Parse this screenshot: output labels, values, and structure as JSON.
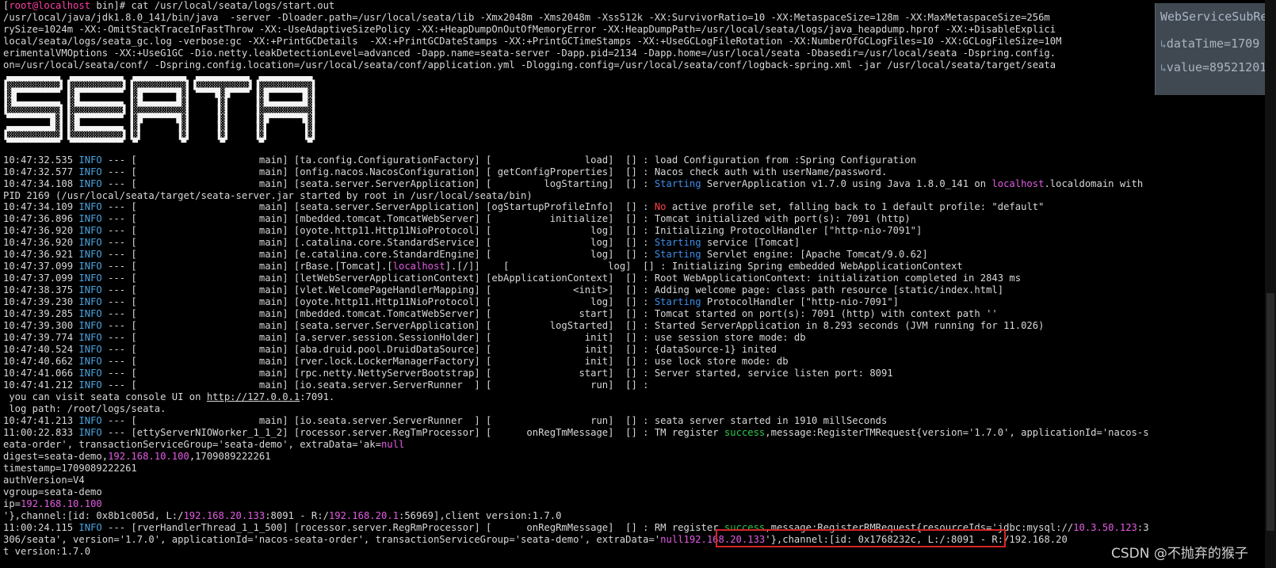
{
  "terminal": {
    "prompt_user": "root@",
    "prompt_host": "localhost",
    "prompt_rest": " bin]# cat /usr/local/seata/logs/start.out",
    "cmd_lines": [
      "/usr/local/java/jdk1.8.0_141/bin/java  -server -Dloader.path=/usr/local/seata/lib -Xmx2048m -Xms2048m -Xss512k -XX:SurvivorRatio=10 -XX:MetaspaceSize=128m -XX:MaxMetaspaceSize=256m",
      "rySize=1024m -XX:-OmitStackTraceInFastThrow -XX:-UseAdaptiveSizePolicy -XX:+HeapDumpOnOutOfMemoryError -XX:HeapDumpPath=/usr/local/seata/logs/java_heapdump.hprof -XX:+DisableExplici",
      "local/seata/logs/seata_gc.log -verbose:gc -XX:+PrintGCDetails  -XX:+PrintGCDateStamps -XX:+PrintGCTimeStamps -XX:+UseGCLogFileRotation -XX:NumberOfGCLogFiles=10 -XX:GCLogFileSize=10M",
      "erimentalVMOptions -XX:+UseG1GC -Dio.netty.leakDetectionLevel=advanced -Dapp.name=seata-server -Dapp.pid=2134 -Dapp.home=/usr/local/seata -Dbasedir=/usr/local/seata -Dspring.config.",
      "on=/usr/local/seata/conf/ -Dspring.config.location=/usr/local/seata/conf/application.yml -Dlogging.config=/usr/local/seata/conf/logback-spring.xml -jar /usr/local/seata/target/seata"
    ],
    "ascii_logo": " ▄▄▄▄▄▄▄▄▄▄▄  ▄▄▄▄▄▄▄▄▄▄▄  ▄▄▄▄▄▄▄▄▄▄▄  ▄▄▄▄▄▄▄▄▄▄▄  ▄▄▄▄▄▄▄▄▄▄▄ \n▐░░░░░░░░░░░▌▐░░░░░░░░░░░▌▐░░░░░░░░░░░▌▐░░░░░░░░░░░▌▐░░░░░░░░░░░▌\n▐░█▀▀▀▀▀▀▀▀▀ ▐░█▀▀▀▀▀▀▀▀▀ ▐░█▀▀▀▀▀▀▀█░▌ ▀▀▀▀█░█▀▀▀▀ ▐░█▀▀▀▀▀▀▀█░▌\n▐░█▄▄▄▄▄▄▄▄▄ ▐░█▄▄▄▄▄▄▄▄▄ ▐░█▄▄▄▄▄▄▄█░▌     ▐░▌     ▐░█▄▄▄▄▄▄▄█░▌\n▐░░░░░░░░░░░▌▐░░░░░░░░░░░▌▐░░░░░░░░░░░▌     ▐░▌     ▐░░░░░░░░░░░▌\n ▀▀▀▀▀▀▀▀▀█░▌▐░█▀▀▀▀▀▀▀▀▀ ▐░█▀▀▀▀▀▀▀█░▌     ▐░▌     ▐░█▀▀▀▀▀▀▀█░▌\n ▄▄▄▄▄▄▄▄▄█░▌▐░█▄▄▄▄▄▄▄▄▄ ▐░▌       ▐░▌     ▐░▌     ▐░▌       ▐░▌\n▐░░░░░░░░░░░▌▐░░░░░░░░░░░▌▐░▌       ▐░▌     ▐░▌     ▐░▌       ▐░▌\n ▀▀▀▀▀▀▀▀▀▀▀  ▀▀▀▀▀▀▀▀▀▀▀  ▀         ▀       ▀       ▀         ▀ ",
    "log": [
      {
        "time": "10:47:32.535",
        "level": "INFO",
        "thread": "main",
        "logger": "[ta.config.ConfigurationFactory]",
        "method": "load",
        "msg": "load Configuration from :Spring Configuration"
      },
      {
        "time": "10:47:32.577",
        "level": "INFO",
        "thread": "main",
        "logger": "[onfig.nacos.NacosConfiguration]",
        "method": "getConfigProperties",
        "msg": "Nacos check auth with userName/password."
      },
      {
        "time": "10:47:34.108",
        "level": "INFO",
        "thread": "main",
        "logger": "[seata.server.ServerApplication]",
        "method": "logStarting",
        "msg_start": "Starting",
        "msg": " ServerApplication v1.7.0 using Java 1.8.0_141 on ",
        "msg_host": "localhost",
        "msg_tail": ".localdomain with"
      },
      {
        "raw": "PID 2169 (/usr/local/seata/target/seata-server.jar started by root in /usr/local/seata/bin)"
      },
      {
        "time": "10:47:34.109",
        "level": "INFO",
        "thread": "main",
        "logger": "[seata.server.ServerApplication]",
        "method": "ogStartupProfileInfo",
        "msg_no": "No",
        "msg": " active profile set, falling back to 1 default profile: \"default\""
      },
      {
        "time": "10:47:36.896",
        "level": "INFO",
        "thread": "main",
        "logger": "[mbedded.tomcat.TomcatWebServer]",
        "method": "initialize",
        "msg": "Tomcat initialized with port(s): 7091 (http)"
      },
      {
        "time": "10:47:36.920",
        "level": "INFO",
        "thread": "main",
        "logger": "[oyote.http11.Http11NioProtocol]",
        "method": "log",
        "msg": "Initializing ProtocolHandler [\"http-nio-7091\"]"
      },
      {
        "time": "10:47:36.920",
        "level": "INFO",
        "thread": "main",
        "logger": "[.catalina.core.StandardService]",
        "method": "log",
        "msg_start": "Starting",
        "msg": " service [Tomcat]"
      },
      {
        "time": "10:47:36.921",
        "level": "INFO",
        "thread": "main",
        "logger": "[e.catalina.core.StandardEngine]",
        "method": "log",
        "msg_start": "Starting",
        "msg": " Servlet engine: [Apache Tomcat/9.0.62]"
      },
      {
        "time": "10:47:37.099",
        "level": "INFO",
        "thread": "main",
        "logger_pre": "[rBase.[Tomcat].[",
        "logger_host": "localhost",
        "logger_post": "].[/]]",
        "method": "log",
        "msg": "Initializing Spring embedded WebApplicationContext"
      },
      {
        "time": "10:47:37.099",
        "level": "INFO",
        "thread": "main",
        "logger": "[letWebServerApplicationContext]",
        "method": "ebApplicationContext",
        "msg": "Root WebApplicationContext: initialization completed in 2843 ms"
      },
      {
        "time": "10:47:38.375",
        "level": "INFO",
        "thread": "main",
        "logger": "[vlet.WelcomePageHandlerMapping]",
        "method": "<init>",
        "msg": "Adding welcome page: class path resource [static/index.html]"
      },
      {
        "time": "10:47:39.230",
        "level": "INFO",
        "thread": "main",
        "logger": "[oyote.http11.Http11NioProtocol]",
        "method": "log",
        "msg_start": "Starting",
        "msg": " ProtocolHandler [\"http-nio-7091\"]"
      },
      {
        "time": "10:47:39.285",
        "level": "INFO",
        "thread": "main",
        "logger": "[mbedded.tomcat.TomcatWebServer]",
        "method": "start",
        "msg": "Tomcat started on port(s): 7091 (http) with context path ''"
      },
      {
        "time": "10:47:39.300",
        "level": "INFO",
        "thread": "main",
        "logger": "[seata.server.ServerApplication]",
        "method": "logStarted",
        "msg": "Started ServerApplication in 8.293 seconds (JVM running for 11.026)"
      },
      {
        "time": "10:47:39.774",
        "level": "INFO",
        "thread": "main",
        "logger": "[a.server.session.SessionHolder]",
        "method": "init",
        "msg": "use session store mode: db"
      },
      {
        "time": "10:47:40.524",
        "level": "INFO",
        "thread": "main",
        "logger": "[aba.druid.pool.DruidDataSource]",
        "method": "init",
        "msg": "{dataSource-1} inited"
      },
      {
        "time": "10:47:40.662",
        "level": "INFO",
        "thread": "main",
        "logger": "[rver.lock.LockerManagerFactory]",
        "method": "init",
        "msg": "use lock store mode: db"
      },
      {
        "time": "10:47:41.066",
        "level": "INFO",
        "thread": "main",
        "logger": "[rpc.netty.NettyServerBootstrap]",
        "method": "start",
        "msg": "Server started, service listen port: 8091"
      },
      {
        "time": "10:47:41.212",
        "level": "INFO",
        "thread": "main",
        "logger": "[io.seata.server.ServerRunner  ]",
        "method": "run",
        "msg": ""
      },
      {
        "raw_pre": " you can visit seata console UI on ",
        "raw_url": "http://127.0.0.1",
        "raw_post": ":7091."
      },
      {
        "raw": " log path: /root/logs/seata."
      },
      {
        "time": "10:47:41.213",
        "level": "INFO",
        "thread": "main",
        "logger": "[io.seata.server.ServerRunner  ]",
        "method": "run",
        "msg": "seata server started in 1910 millSeconds"
      },
      {
        "time": "11:00:22.833",
        "level": "INFO",
        "thread": "ettyServerNIOWorker_1_1_2",
        "logger": "[rocessor.server.RegTmProcessor]",
        "method": "onRegTmMessage",
        "msg": "TM register ",
        "msg_succ": "success",
        "msg_tail": ",message:RegisterTMRequest{version='1.7.0', applicationId='nacos-s"
      },
      {
        "raw_pre": "eata-order', transactionServiceGroup='seata-demo', extraData='ak=",
        "raw_null": "null"
      },
      {
        "raw_pre": "digest=seata-demo,",
        "raw_ip": "192.168.10.100",
        "raw_post": ",1709089222261"
      },
      {
        "raw": "timestamp=1709089222261"
      },
      {
        "raw": "authVersion=V4"
      },
      {
        "raw": "vgroup=seata-demo"
      },
      {
        "raw_pre": "ip=",
        "raw_ip": "192.168.10.100"
      },
      {
        "raw_pre": "'},channel:[id: 0x8b1c005d, L:/",
        "raw_ip": "192.168.20.133",
        "raw_mid": ":8091 - R:/",
        "raw_ip2": "192.168.20.1",
        "raw_post": ":56969],client version:1.7.0"
      },
      {
        "time": "11:00:24.115",
        "level": "INFO",
        "thread": "rverHandlerThread_1_1_500",
        "logger": "[rocessor.server.RegRmProcessor]",
        "method": "onRegRmMessage",
        "msg": "RM register ",
        "msg_succ": "success",
        "msg_tail": ",message:RegisterRMRequest{resourceIds='jdbc:mysql://",
        "msg_ip": "10.3.50.123",
        "msg_end": ":3"
      },
      {
        "raw_pre": "306/seata', version='1.7.0', applicationId='nacos-seata-order', transactionServiceGroup='seata-demo', extraData='",
        "raw_null": "null",
        "raw_mid": "'},channel:[id: 0x1768232c, L:/",
        "raw_ip": "192.168.20.133",
        "raw_post": ":8091 - R:/192.168.20"
      },
      {
        "raw": "t version:1.7.0"
      }
    ]
  },
  "popup": {
    "title": "WebServiceSubRe",
    "row1": "dataTime=1709",
    "row2": "value=89521201",
    "arrow_icon": "return-arrow-icon"
  },
  "watermark": "CSDN @不抛弃的猴子",
  "colors": {
    "background": "#000000",
    "text": "#d8d8d8",
    "info": "#4aa3df",
    "starting": "#3d8ee8",
    "success": "#2cc94d",
    "ip": "#e35ce3",
    "error": "#ff4444",
    "highlight_box": "#d62525"
  }
}
